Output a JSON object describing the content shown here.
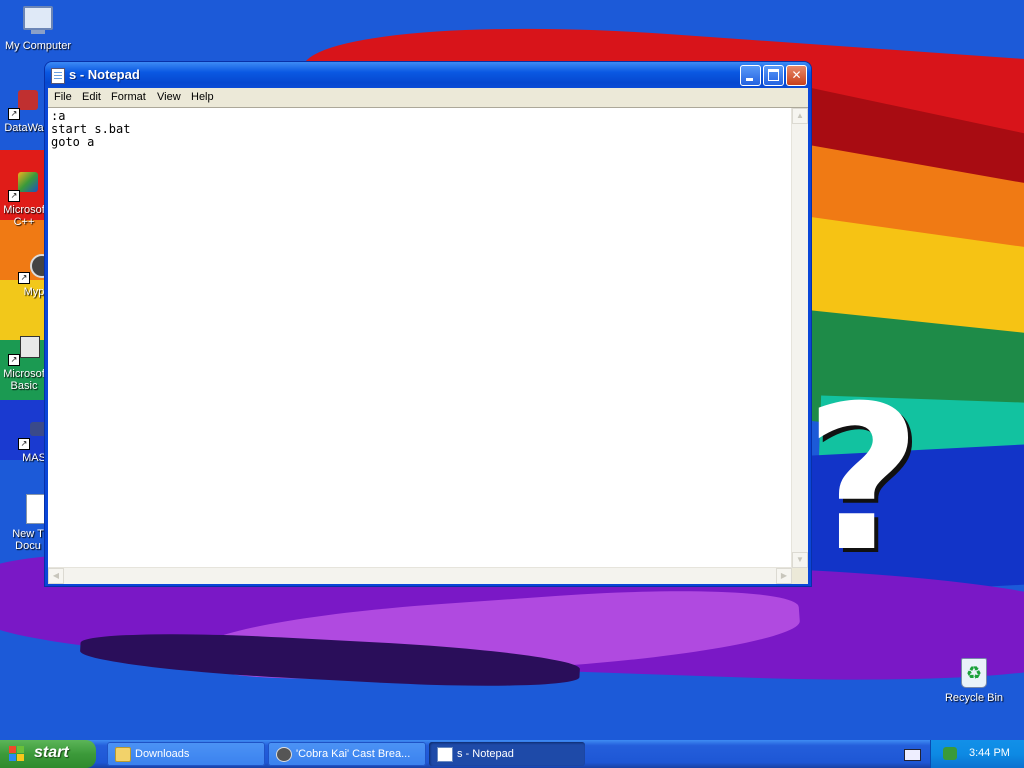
{
  "desktop": {
    "icons": [
      {
        "label": "My Computer",
        "icon": "my-computer-icon"
      },
      {
        "label": "DataWa",
        "icon": "shortcut-icon"
      },
      {
        "label": "Microsof C++",
        "icon": "shortcut-icon"
      },
      {
        "label": "Myp",
        "icon": "shortcut-icon"
      },
      {
        "label": "Microsof Basic",
        "icon": "shortcut-icon"
      },
      {
        "label": "MAS",
        "icon": "shortcut-icon"
      },
      {
        "label": "New T Docu",
        "icon": "text-document-icon"
      },
      {
        "label": "Recycle Bin",
        "icon": "recycle-bin-icon"
      }
    ]
  },
  "notepad": {
    "title": "s - Notepad",
    "menu": [
      "File",
      "Edit",
      "Format",
      "View",
      "Help"
    ],
    "content": ":a\nstart s.bat\ngoto a"
  },
  "taskbar": {
    "start_label": "start",
    "tasks": [
      {
        "label": "Downloads",
        "icon": "folder-icon"
      },
      {
        "label": "'Cobra Kai' Cast Brea...",
        "icon": "raccoon-icon"
      },
      {
        "label": "s - Notepad",
        "icon": "notepad-icon",
        "active": true
      }
    ],
    "clock": "3:44 PM"
  },
  "colors": {
    "title_bar": "#0a58e2",
    "start_button": "#3c9a3a",
    "taskbar": "#245edb",
    "tray": "#0d8ae4"
  }
}
